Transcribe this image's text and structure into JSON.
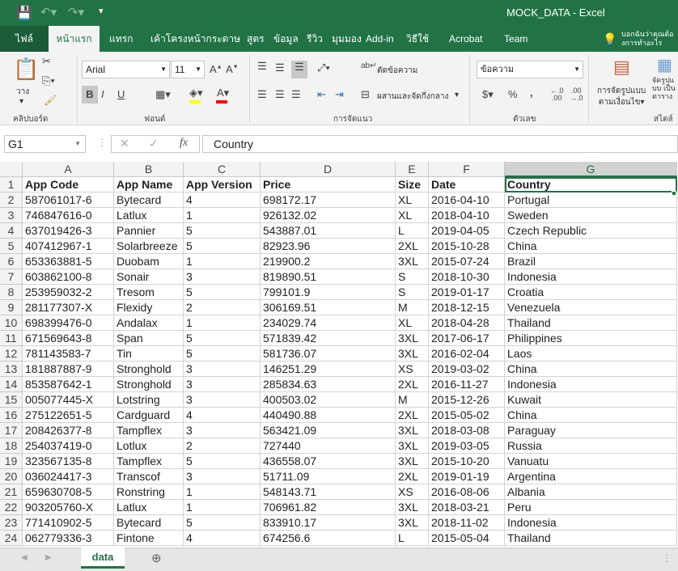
{
  "window": {
    "title": "MOCK_DATA  -  Excel",
    "qat": [
      "save-icon",
      "undo-icon",
      "redo-icon",
      "customize-icon"
    ]
  },
  "tabs": [
    "ไฟล์",
    "หน้าแรก",
    "แทรก",
    "เค้าโครงหน้ากระดาษ",
    "สูตร",
    "ข้อมูล",
    "รีวิว",
    "มุมมอง",
    "Add-in",
    "วิธีใช้",
    "Acrobat",
    "Team"
  ],
  "tell_me": "บอกฉันว่าคุณต้องการทำอะไร",
  "ribbon": {
    "clipboard": {
      "paste": "วาง",
      "label": "คลิปบอร์ด"
    },
    "font": {
      "name": "Arial",
      "size": "11",
      "bold": "B",
      "italic": "I",
      "underline": "U",
      "label": "ฟอนต์",
      "fill_color": "#ffff00",
      "font_color": "#ff0000"
    },
    "alignment": {
      "wrap": "ตัดข้อความ",
      "merge": "ผสานและจัดกึ่งกลาง",
      "label": "การจัดแนว"
    },
    "number": {
      "format": "ข้อความ",
      "label": "ตัวเลข",
      "currency": "$",
      "percent": "%",
      "comma": ","
    },
    "styles": {
      "conditional": [
        "การจัดรูปแบบ",
        "ตามเงื่อนไข"
      ],
      "table": [
        "จัดรูปแบบ",
        "เป็นตาราง"
      ],
      "label": "สไตล์"
    }
  },
  "formula_bar": {
    "name_box": "G1",
    "fx": "fx",
    "value": "Country"
  },
  "columns": [
    "A",
    "B",
    "C",
    "D",
    "E",
    "F",
    "G"
  ],
  "header": [
    "App Code",
    "App Name",
    "App Version",
    "Price",
    "Size",
    "Date",
    "Country"
  ],
  "rows": [
    [
      "587061017-6",
      "Bytecard",
      "4",
      "698172.17",
      "XL",
      "2016-04-10",
      "Portugal"
    ],
    [
      "746847616-0",
      "Latlux",
      "1",
      "926132.02",
      "XL",
      "2018-04-10",
      "Sweden"
    ],
    [
      "637019426-3",
      "Pannier",
      "5",
      "543887.01",
      "L",
      "2019-04-05",
      "Czech Republic"
    ],
    [
      "407412967-1",
      "Solarbreeze",
      "5",
      "82923.96",
      "2XL",
      "2015-10-28",
      "China"
    ],
    [
      "653363881-5",
      "Duobam",
      "1",
      "219900.2",
      "3XL",
      "2015-07-24",
      "Brazil"
    ],
    [
      "603862100-8",
      "Sonair",
      "3",
      "819890.51",
      "S",
      "2018-10-30",
      "Indonesia"
    ],
    [
      "253959032-2",
      "Tresom",
      "5",
      "799101.9",
      "S",
      "2019-01-17",
      "Croatia"
    ],
    [
      "281177307-X",
      "Flexidy",
      "2",
      "306169.51",
      "M",
      "2018-12-15",
      "Venezuela"
    ],
    [
      "698399476-0",
      "Andalax",
      "1",
      "234029.74",
      "XL",
      "2018-04-28",
      "Thailand"
    ],
    [
      "671569643-8",
      "Span",
      "5",
      "571839.42",
      "3XL",
      "2017-06-17",
      "Philippines"
    ],
    [
      "781143583-7",
      "Tin",
      "5",
      "581736.07",
      "3XL",
      "2016-02-04",
      "Laos"
    ],
    [
      "181887887-9",
      "Stronghold",
      "3",
      "146251.29",
      "XS",
      "2019-03-02",
      "China"
    ],
    [
      "853587642-1",
      "Stronghold",
      "3",
      "285834.63",
      "2XL",
      "2016-11-27",
      "Indonesia"
    ],
    [
      "005077445-X",
      "Lotstring",
      "3",
      "400503.02",
      "M",
      "2015-12-26",
      "Kuwait"
    ],
    [
      "275122651-5",
      "Cardguard",
      "4",
      "440490.88",
      "2XL",
      "2015-05-02",
      "China"
    ],
    [
      "208426377-8",
      "Tampflex",
      "3",
      "563421.09",
      "3XL",
      "2018-03-08",
      "Paraguay"
    ],
    [
      "254037419-0",
      "Lotlux",
      "2",
      "727440",
      "3XL",
      "2019-03-05",
      "Russia"
    ],
    [
      "323567135-8",
      "Tampflex",
      "5",
      "436558.07",
      "3XL",
      "2015-10-20",
      "Vanuatu"
    ],
    [
      "036024417-3",
      "Transcof",
      "3",
      "51711.09",
      "2XL",
      "2019-01-19",
      "Argentina"
    ],
    [
      "659630708-5",
      "Ronstring",
      "1",
      "548143.71",
      "XS",
      "2016-08-06",
      "Albania"
    ],
    [
      "903205760-X",
      "Latlux",
      "1",
      "706961.82",
      "3XL",
      "2018-03-21",
      "Peru"
    ],
    [
      "771410902-5",
      "Bytecard",
      "5",
      "833910.17",
      "3XL",
      "2018-11-02",
      "Indonesia"
    ],
    [
      "062779336-3",
      "Fintone",
      "4",
      "674256.6",
      "L",
      "2015-05-04",
      "Thailand"
    ]
  ],
  "sheets": [
    {
      "name": "data",
      "active": true
    }
  ],
  "colors": {
    "accent": "#217346"
  }
}
